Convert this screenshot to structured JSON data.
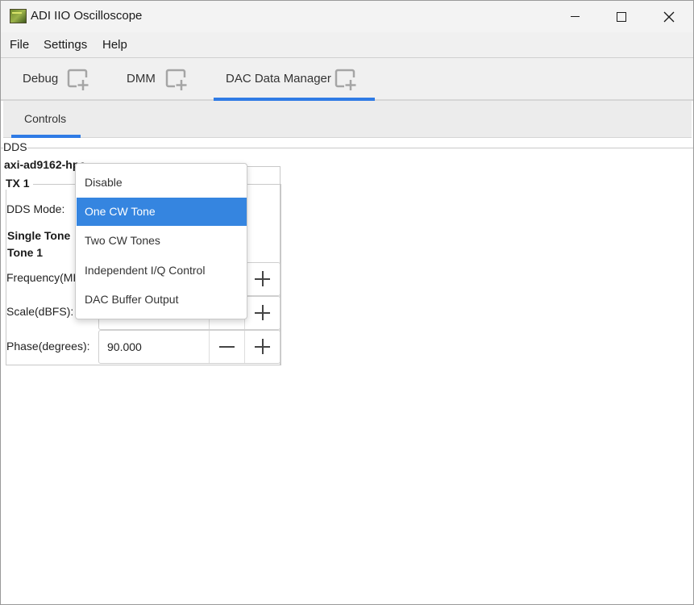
{
  "window": {
    "title": "ADI IIO Oscilloscope",
    "app_icon": "oscilloscope-app-icon",
    "controls": {
      "minimize": "minimize-icon",
      "maximize": "maximize-icon",
      "close": "close-icon"
    }
  },
  "menubar": {
    "items": [
      {
        "label": "File"
      },
      {
        "label": "Settings"
      },
      {
        "label": "Help"
      }
    ]
  },
  "tabs": [
    {
      "label": "Debug",
      "icon": "detach-tab-icon",
      "active": false
    },
    {
      "label": "DMM",
      "icon": "detach-tab-icon",
      "active": false
    },
    {
      "label": "DAC Data Manager",
      "icon": "detach-tab-icon",
      "active": true
    }
  ],
  "accent_color": "#2f7be5",
  "subtabs": [
    {
      "label": "Controls",
      "active": true
    }
  ],
  "dds": {
    "section_label": "DDS",
    "device_label": "axi-ad9162-hpc",
    "tx_label": "TX 1",
    "mode_label": "DDS Mode:",
    "single_tone_label": "Single Tone",
    "tone_label": "Tone 1",
    "frequency_label": "Frequency(MHz):",
    "scale_label": "Scale(dBFS):",
    "phase_label": "Phase(degrees):",
    "phase_value": "90.000",
    "frequency_value": "",
    "scale_value": ""
  },
  "dropdown": {
    "options": [
      {
        "label": "Disable",
        "selected": false
      },
      {
        "label": "One CW Tone",
        "selected": true
      },
      {
        "label": "Two CW Tones",
        "selected": false
      },
      {
        "label": "Independent I/Q Control",
        "selected": false
      },
      {
        "label": "DAC Buffer Output",
        "selected": false
      }
    ],
    "highlight_color": "#3585e0"
  }
}
